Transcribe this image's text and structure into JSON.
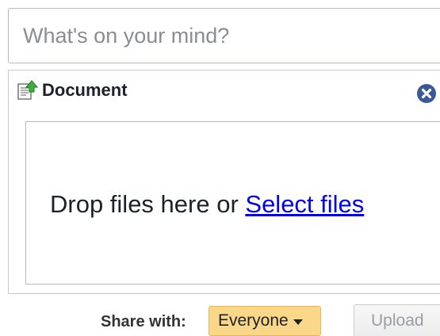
{
  "status": {
    "placeholder": "What's on your mind?"
  },
  "document_panel": {
    "title": "Document",
    "icon": "document-upload-icon",
    "close_icon": "close-icon",
    "drop_text": "Drop files here or ",
    "select_link": "Select files"
  },
  "share": {
    "label": "Share with:",
    "selected": "Everyone",
    "dropdown_icon": "caret-down-icon",
    "dropdown_color": "#fbd789"
  },
  "upload_button": {
    "label": "Upload",
    "disabled": true
  },
  "colors": {
    "link": "#0000ee",
    "close": "#3b5998"
  }
}
